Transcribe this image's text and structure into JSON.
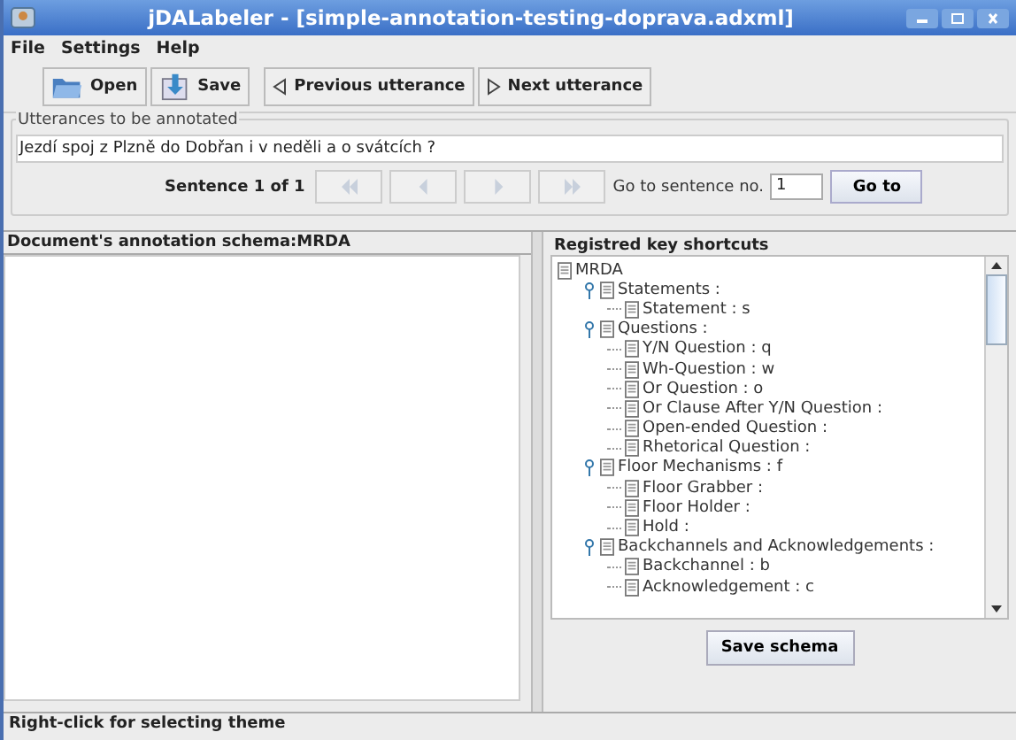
{
  "window": {
    "title": "jDALabeler - [simple-annotation-testing-doprava.adxml]"
  },
  "menu": [
    "File",
    "Settings",
    "Help"
  ],
  "toolbar": [
    {
      "kind": "open",
      "label": "Open"
    },
    {
      "kind": "save",
      "label": "Save"
    },
    {
      "kind": "prev",
      "label": "Previous utterance"
    },
    {
      "kind": "next",
      "label": "Next utterance"
    }
  ],
  "utterances": {
    "title": "Utterances to be annotated",
    "text": "Jezdí spoj z Plzně do Dobřan i v neděli a o svátcích ?",
    "counter": "Sentence 1 of 1",
    "nav": [
      {
        "kind": "first",
        "disabled": true
      },
      {
        "kind": "prev",
        "disabled": true
      },
      {
        "kind": "next",
        "disabled": true
      },
      {
        "kind": "last",
        "disabled": true
      }
    ],
    "goto_label": "Go to sentence no.",
    "goto_value": "1",
    "goto_button": "Go to"
  },
  "schema_header": "Document's annotation schema:MRDA",
  "shortcuts": {
    "title": "Registred key shortcuts",
    "tree": [
      {
        "label": "MRDA",
        "children": [
          {
            "label": "Statements :",
            "expanded": true,
            "children": [
              {
                "label": "Statement : s"
              }
            ]
          },
          {
            "label": "Questions :",
            "expanded": true,
            "children": [
              {
                "label": "Y/N Question : q"
              },
              {
                "label": "Wh-Question : w"
              },
              {
                "label": "Or Question : o"
              },
              {
                "label": "Or Clause After Y/N Question :"
              },
              {
                "label": "Open-ended Question :"
              },
              {
                "label": "Rhetorical Question :"
              }
            ]
          },
          {
            "label": "Floor Mechanisms : f",
            "expanded": true,
            "children": [
              {
                "label": "Floor Grabber :"
              },
              {
                "label": "Floor Holder :"
              },
              {
                "label": "Hold :"
              }
            ]
          },
          {
            "label": "Backchannels and Acknowledgements :",
            "expanded": true,
            "children": [
              {
                "label": "Backchannel : b"
              },
              {
                "label": "Acknowledgement : c"
              }
            ]
          }
        ]
      }
    ],
    "save_button": "Save schema"
  },
  "status_bar": "Right-click for selecting theme"
}
